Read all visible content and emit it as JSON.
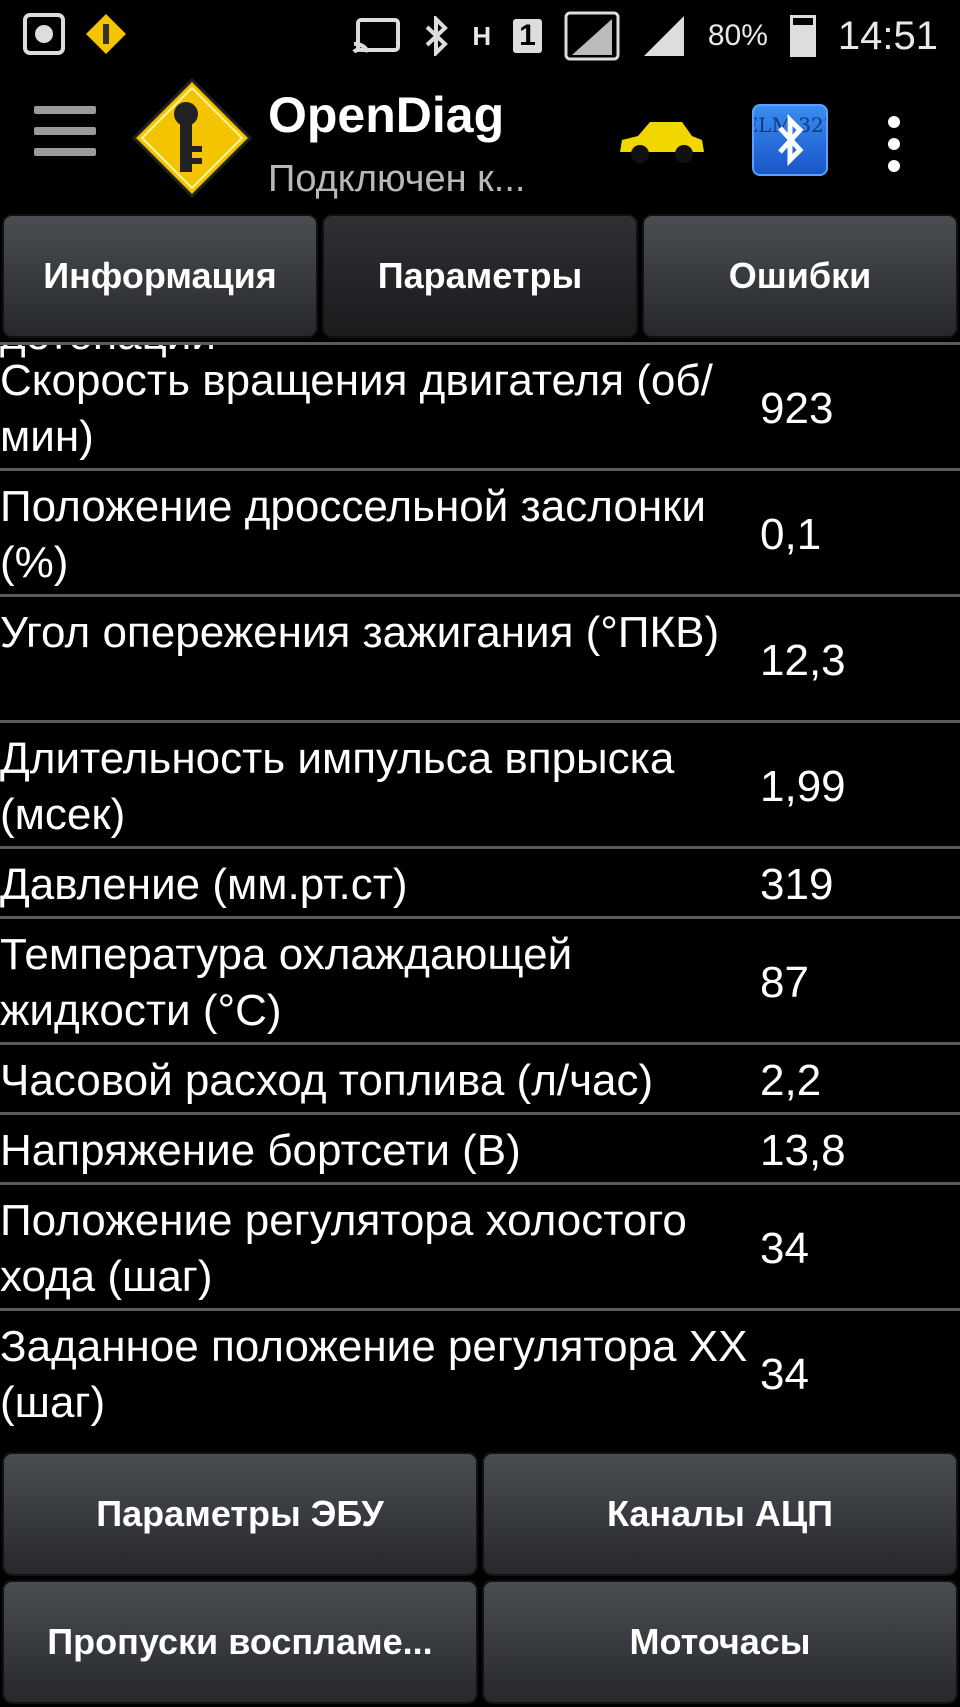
{
  "status_bar": {
    "battery": "80%",
    "time": "14:51",
    "network_letter": "H",
    "sim_slot": "1",
    "icons": [
      "screenshot-icon",
      "app-key-icon",
      "cast-icon",
      "bluetooth-icon",
      "data-arrows-icon",
      "signal-icon",
      "signal-icon",
      "battery-icon"
    ]
  },
  "app_bar": {
    "title": "OpenDiag",
    "subtitle": "Подключен к...",
    "elm_label": "ELM 327",
    "icons": [
      "menu-icon",
      "opendiag-logo",
      "car-icon",
      "elm327-bluetooth-icon",
      "overflow-menu-icon"
    ]
  },
  "colors": {
    "background": "#000000",
    "divider": "#5b5b5b",
    "button": "#3a3d41",
    "logo_yellow": "#f5c400",
    "car_yellow": "#f2d600"
  },
  "tabs": [
    {
      "label": "Информация",
      "active": false
    },
    {
      "label": "Параметры",
      "active": true
    },
    {
      "label": "Ошибки",
      "active": false
    }
  ],
  "parameters": {
    "partial_top": "детонации",
    "rows": [
      {
        "name": "Скорость вращения двигателя (об/мин)",
        "value": "923"
      },
      {
        "name": "Положение дроссельной заслонки (%)",
        "value": "0,1"
      },
      {
        "name": "Угол опережения зажигания (°ПКВ)",
        "value": "12,3"
      },
      {
        "name": "Длительность импульса впрыска (мсек)",
        "value": "1,99"
      },
      {
        "name": "Давление (мм.рт.ст)",
        "value": "319"
      },
      {
        "name": "Температура охлаждающей жидкости (°С)",
        "value": "87"
      },
      {
        "name": "Часовой расход топлива (л/час)",
        "value": "2,2"
      },
      {
        "name": "Напряжение бортсети (В)",
        "value": "13,8"
      },
      {
        "name": "Положение регулятора холостого хода (шаг)",
        "value": "34"
      },
      {
        "name": "Заданное положение регулятора XX (шаг)",
        "value": "34"
      }
    ]
  },
  "bottom_buttons": [
    {
      "label": "Параметры ЭБУ"
    },
    {
      "label": "Каналы АЦП"
    },
    {
      "label": "Пропуски воспламе..."
    },
    {
      "label": "Моточасы"
    }
  ]
}
